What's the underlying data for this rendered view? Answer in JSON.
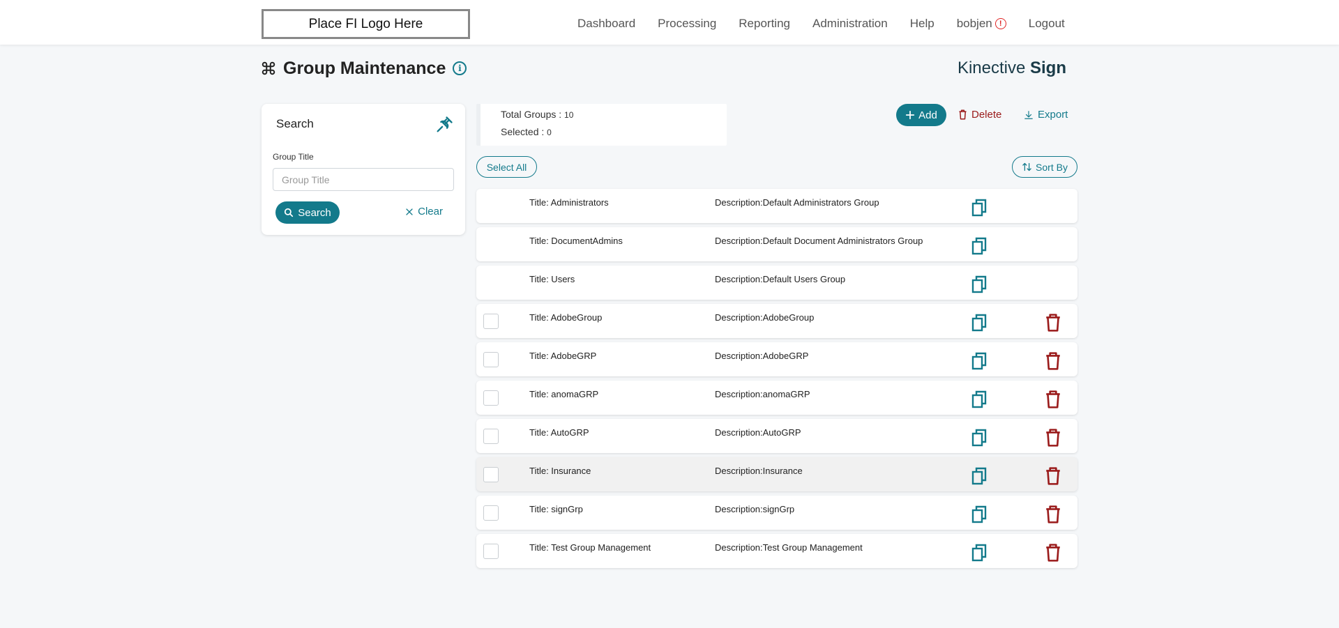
{
  "header": {
    "logo_text": "Place FI Logo Here",
    "nav": [
      "Dashboard",
      "Processing",
      "Reporting",
      "Administration",
      "Help",
      "bobjen",
      "Logout"
    ],
    "alert_icon": "exclamation-circle-icon",
    "alert_color": "#e02424"
  },
  "page": {
    "title": "Group Maintenance",
    "title_icon": "command-icon",
    "info_icon": "info-icon",
    "brand_regular": "Kinective",
    "brand_bold": "Sign",
    "accent_color": "#137a8b",
    "danger_color": "#9a1a1a"
  },
  "search_panel": {
    "title": "Search",
    "pin_icon": "pin-icon",
    "field_label": "Group Title",
    "field_placeholder": "Group Title",
    "field_value": "",
    "search_button": "Search",
    "clear_button": "Clear"
  },
  "summary": {
    "total_label": "Total Groups :",
    "total_value": "10",
    "selected_label": "Selected :",
    "selected_value": "0"
  },
  "toolbar": {
    "add": "Add",
    "delete": "Delete",
    "export": "Export",
    "select_all": "Select All",
    "sort_by": "Sort By"
  },
  "groups": [
    {
      "title": "Title: Administrators",
      "description": "Description:Default Administrators Group",
      "deletable": false
    },
    {
      "title": "Title: DocumentAdmins",
      "description": "Description:Default Document Administrators Group",
      "deletable": false
    },
    {
      "title": "Title: Users",
      "description": "Description:Default Users Group",
      "deletable": false
    },
    {
      "title": "Title: AdobeGroup",
      "description": "Description:AdobeGroup",
      "deletable": true
    },
    {
      "title": "Title: AdobeGRP",
      "description": "Description:AdobeGRP",
      "deletable": true
    },
    {
      "title": "Title: anomaGRP",
      "description": "Description:anomaGRP",
      "deletable": true
    },
    {
      "title": "Title: AutoGRP",
      "description": "Description:AutoGRP",
      "deletable": true
    },
    {
      "title": "Title: Insurance",
      "description": "Description:Insurance",
      "deletable": true,
      "highlighted": true
    },
    {
      "title": "Title: signGrp",
      "description": "Description:signGrp",
      "deletable": true
    },
    {
      "title": "Title: Test Group Management",
      "description": "Description:Test Group Management",
      "deletable": true
    }
  ]
}
